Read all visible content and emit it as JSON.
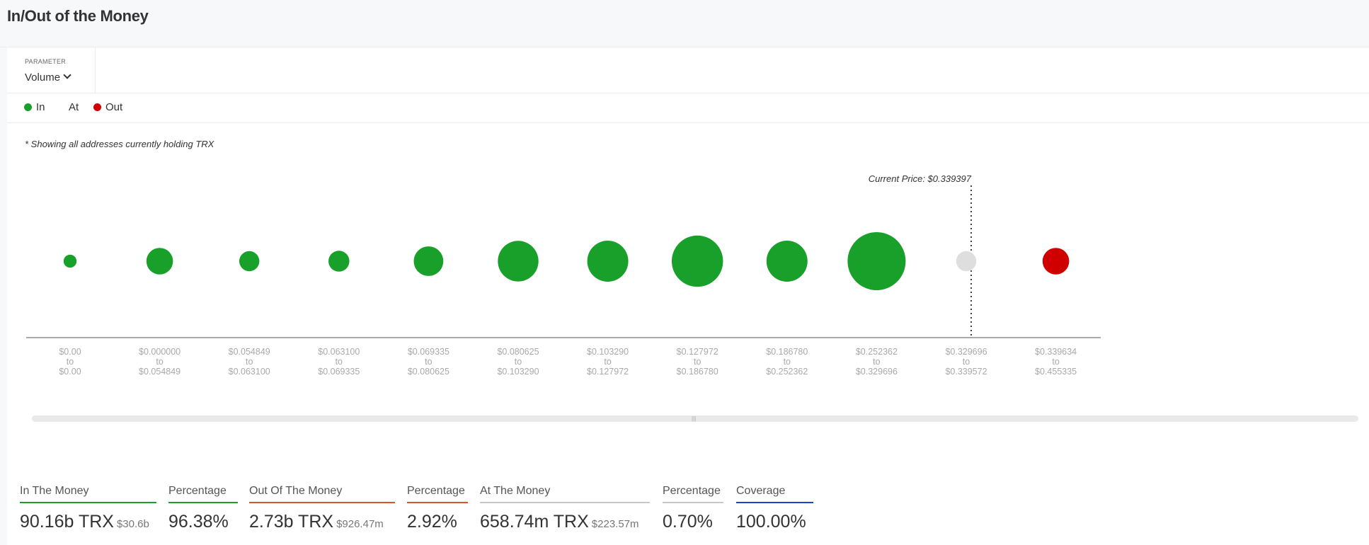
{
  "page": {
    "title": "In/Out of the Money"
  },
  "parameter": {
    "label": "PARAMETER",
    "value": "Volume"
  },
  "legend": [
    {
      "label": "In",
      "color": "#18a02a"
    },
    {
      "label": "At",
      "color": "#ffffff"
    },
    {
      "label": "Out",
      "color": "#d00000"
    }
  ],
  "note": "* Showing all addresses currently holding TRX",
  "chart_data": {
    "type": "bubble",
    "current_price_label": "Current Price: $0.339397",
    "current_price": 0.339397,
    "colors": {
      "in": "#18a02a",
      "at": "#dedede",
      "out": "#d00000"
    },
    "categories": [
      [
        "$0.00",
        "to",
        "$0.00"
      ],
      [
        "$0.000000",
        "to",
        "$0.054849"
      ],
      [
        "$0.054849",
        "to",
        "$0.063100"
      ],
      [
        "$0.063100",
        "to",
        "$0.069335"
      ],
      [
        "$0.069335",
        "to",
        "$0.080625"
      ],
      [
        "$0.080625",
        "to",
        "$0.103290"
      ],
      [
        "$0.103290",
        "to",
        "$0.127972"
      ],
      [
        "$0.127972",
        "to",
        "$0.186780"
      ],
      [
        "$0.186780",
        "to",
        "$0.252362"
      ],
      [
        "$0.252362",
        "to",
        "$0.329696"
      ],
      [
        "$0.329696",
        "to",
        "$0.339572"
      ],
      [
        "$0.339634",
        "to",
        "$0.455335"
      ]
    ],
    "status": [
      "in",
      "in",
      "in",
      "in",
      "in",
      "in",
      "in",
      "in",
      "in",
      "in",
      "at",
      "out"
    ],
    "relative_volume": [
      0.05,
      0.21,
      0.12,
      0.13,
      0.26,
      0.49,
      0.5,
      0.78,
      0.5,
      1.0,
      0.12,
      0.21
    ]
  },
  "summary": [
    {
      "label": "In The Money",
      "value": "90.16b TRX",
      "sub": "$30.6b",
      "color": "#18a02a"
    },
    {
      "label": "Percentage",
      "value": "96.38%",
      "sub": "",
      "color": "#18a02a"
    },
    {
      "label": "Out Of The Money",
      "value": "2.73b TRX",
      "sub": "$926.47m",
      "color": "#e0502a"
    },
    {
      "label": "Percentage",
      "value": "2.92%",
      "sub": "",
      "color": "#e0502a"
    },
    {
      "label": "At The Money",
      "value": "658.74m TRX",
      "sub": "$223.57m",
      "color": "#c8c8c8"
    },
    {
      "label": "Percentage",
      "value": "0.70%",
      "sub": "",
      "color": "#c8c8c8"
    },
    {
      "label": "Coverage",
      "value": "100.00%",
      "sub": "",
      "color": "#1f3fd6"
    }
  ]
}
